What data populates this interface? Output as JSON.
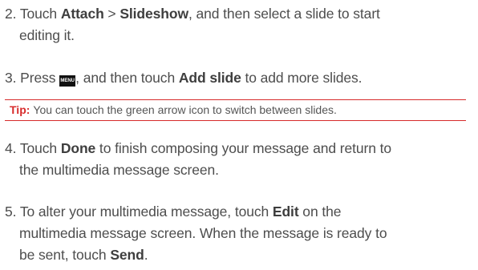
{
  "steps": [
    {
      "number": "2.",
      "lines": [
        {
          "a": " Touch ",
          "b1": "Attach",
          "c": " > ",
          "b2": "Slideshow",
          "d": ", and then select a slide to start"
        },
        {
          "text": "editing it."
        }
      ]
    },
    {
      "number": "3.",
      "lines": [
        {
          "a": " Press ",
          "key": "MENU",
          "b": ", and then touch ",
          "bold": "Add slide",
          "c": " to add more slides."
        }
      ]
    },
    {
      "number": "4.",
      "lines": [
        {
          "a": " Touch ",
          "bold": "Done",
          "b": " to finish composing your message and return to"
        },
        {
          "text": "the multimedia message screen."
        }
      ]
    },
    {
      "number": "5.",
      "lines": [
        {
          "a": " To alter your multimedia message, touch ",
          "bold": "Edit",
          "b": " on the"
        },
        {
          "text": "multimedia message screen. When the message is ready to"
        },
        {
          "a": "be sent, touch ",
          "bold": "Send",
          "b": "."
        }
      ]
    }
  ],
  "tip": {
    "label": "Tip:",
    "text": "You can touch the green arrow icon to switch between slides."
  },
  "colors": {
    "tip_accent": "#d72b2b",
    "body_text": "#4d4d4d"
  },
  "icons": {
    "menu_key": "menu-key-icon"
  }
}
